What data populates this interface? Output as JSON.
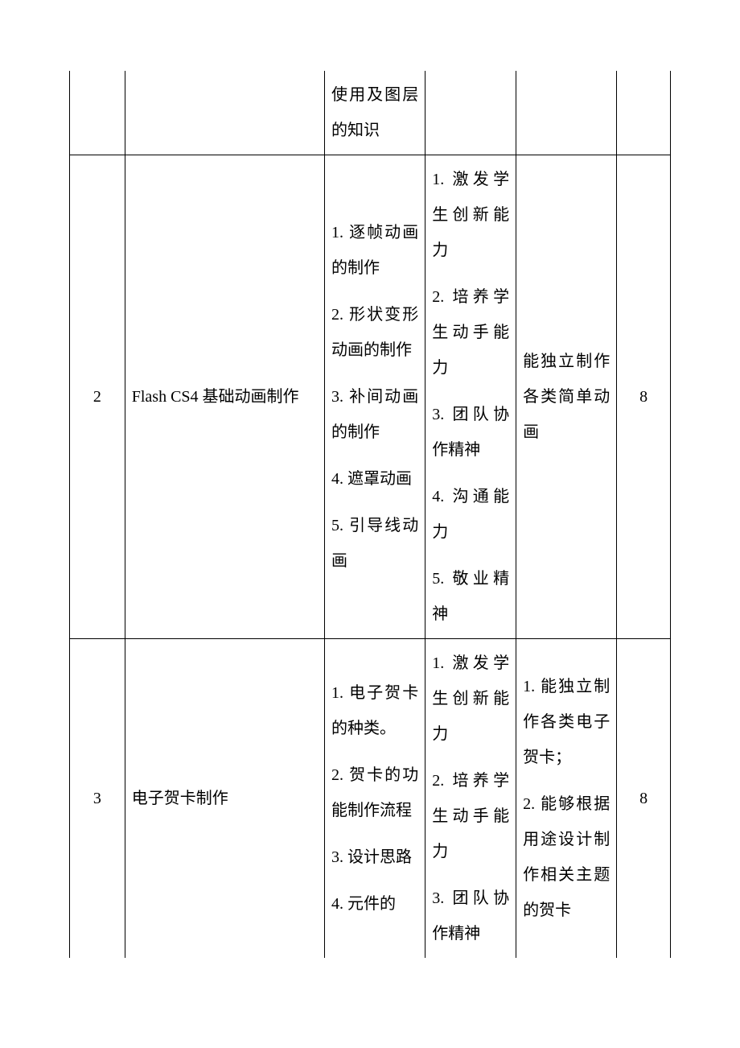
{
  "rows": [
    {
      "idx": "",
      "title": "",
      "knowledge": "使用及图层的知识",
      "ability": "",
      "skill": "",
      "hours": ""
    },
    {
      "idx": "2",
      "title": "Flash CS4 基础动画制作",
      "knowledge_items": [
        "1. 逐帧动画的制作",
        "2. 形状变形动画的制作",
        "3. 补间动画的制作",
        "4. 遮罩动画",
        "5. 引导线动画"
      ],
      "ability_items": [
        "1. 激发学生创新能力",
        "2. 培养学生动手能力",
        "3. 团队协作精神",
        "4. 沟通能力",
        "5. 敬业精神"
      ],
      "skill": "能独立制作各类简单动画",
      "hours": "8"
    },
    {
      "idx": "3",
      "title": "电子贺卡制作",
      "knowledge_items": [
        "1. 电子贺卡的种类。",
        "2. 贺卡的功能制作流程",
        "3. 设计思路",
        "4. 元件的"
      ],
      "ability_items": [
        "1. 激发学生创新能力",
        "2. 培养学生动手能力",
        "3. 团队协作精神"
      ],
      "skill_items": [
        "1. 能独立制作各类电子贺卡；",
        "2. 能够根据用途设计制作相关主题的贺卡"
      ],
      "hours": "8"
    }
  ]
}
